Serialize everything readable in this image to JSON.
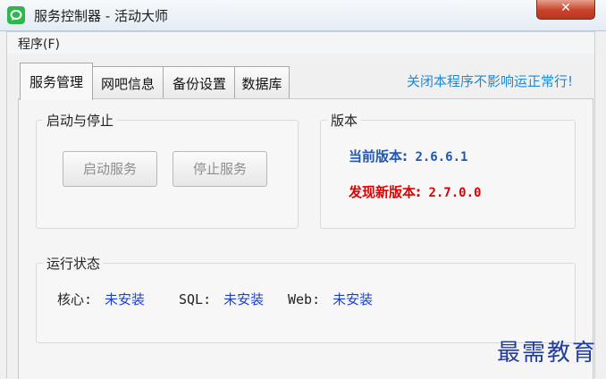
{
  "window": {
    "title": "服务控制器 - 活动大师",
    "close_label": "✕"
  },
  "menu": {
    "program_label": "程序(F)"
  },
  "tabs": [
    {
      "label": "服务管理"
    },
    {
      "label": "网吧信息"
    },
    {
      "label": "备份设置"
    },
    {
      "label": "数据库"
    }
  ],
  "notice": "关闭本程序不影响运正常行!",
  "start_stop": {
    "title": "启动与停止",
    "start_label": "启动服务",
    "stop_label": "停止服务"
  },
  "version": {
    "title": "版本",
    "current_label": "当前版本:",
    "current_value": "2.6.6.1",
    "new_label": "发现新版本:",
    "new_value": "2.7.0.0"
  },
  "status": {
    "title": "运行状态",
    "items": [
      {
        "key": "核心:",
        "value": "未安装"
      },
      {
        "key": "SQL:",
        "value": "未安装"
      },
      {
        "key": "Web:",
        "value": "未安装"
      }
    ]
  },
  "watermark": "最需教育",
  "colors": {
    "notice": "#1b8ad6",
    "current_version": "#1f56b8",
    "new_version": "#e00000",
    "status_value": "#1a3fd8",
    "app_icon": "#2db84c"
  }
}
